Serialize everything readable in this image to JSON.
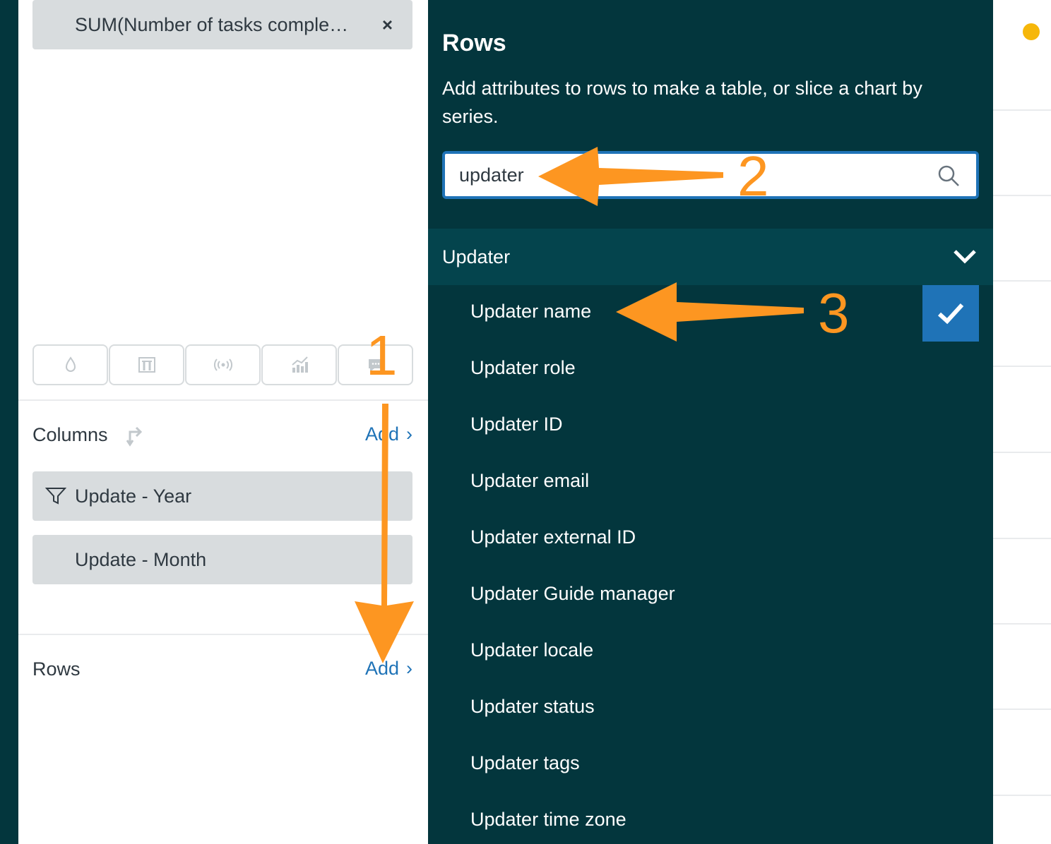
{
  "left_panel": {
    "metric_pill": {
      "label": "SUM(Number of tasks comple…",
      "close": "×"
    },
    "viz_icons": [
      "droplet-icon",
      "bar-filter-icon",
      "broadcast-icon",
      "trend-chart-icon",
      "comment-icon"
    ],
    "columns": {
      "label": "Columns",
      "add_label": "Add",
      "add_chevron": "›",
      "items": [
        {
          "label": "Update - Year",
          "filtered": true
        },
        {
          "label": "Update - Month",
          "filtered": false
        }
      ]
    },
    "rows": {
      "label": "Rows",
      "add_label": "Add",
      "add_chevron": "›"
    }
  },
  "rows_picker": {
    "title": "Rows",
    "description": "Add attributes to rows to make a table, or slice a chart by series.",
    "search": {
      "value": "updater"
    },
    "group": {
      "label": "Updater",
      "expanded": true
    },
    "options": [
      {
        "label": "Updater name",
        "selected": true
      },
      {
        "label": "Updater role",
        "selected": false
      },
      {
        "label": "Updater ID",
        "selected": false
      },
      {
        "label": "Updater email",
        "selected": false
      },
      {
        "label": "Updater external ID",
        "selected": false
      },
      {
        "label": "Updater Guide manager",
        "selected": false
      },
      {
        "label": "Updater locale",
        "selected": false
      },
      {
        "label": "Updater status",
        "selected": false
      },
      {
        "label": "Updater tags",
        "selected": false
      },
      {
        "label": "Updater time zone",
        "selected": false
      }
    ]
  },
  "annotations": {
    "step1": "1",
    "step2": "2",
    "step3": "3",
    "arrow_color": "#fd9621"
  },
  "colors": {
    "sidebar_dark": "#03363d",
    "group_header": "#04444d",
    "accent_blue": "#1f73b7",
    "pill_grey": "#d8dcde",
    "status_yellow": "#f6b70a"
  }
}
